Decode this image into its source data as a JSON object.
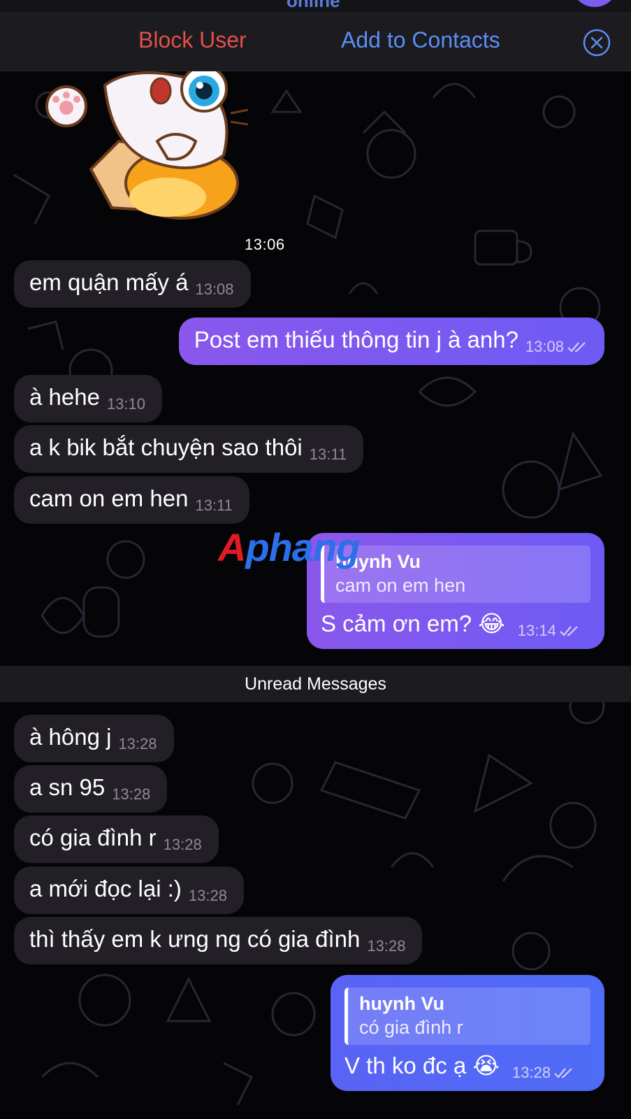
{
  "header": {
    "status_text": "online",
    "block_user": "Block User",
    "add_to_contacts": "Add to Contacts"
  },
  "watermark": {
    "first": "A",
    "rest": "phang"
  },
  "chat": {
    "timestamp_label": "13:06",
    "unread_label": "Unread Messages",
    "messages": [
      {
        "dir": "in",
        "text": "em quận mấy á",
        "time": "13:08"
      },
      {
        "dir": "out",
        "text": "Post em thiếu thông tin j à anh?",
        "time": "13:08"
      },
      {
        "dir": "in",
        "text": "à hehe",
        "time": "13:10"
      },
      {
        "dir": "in",
        "text": "a k bik bắt chuyện sao thôi",
        "time": "13:11"
      },
      {
        "dir": "in",
        "text": "cam on em hen",
        "time": "13:11"
      },
      {
        "dir": "out",
        "reply_name": "huynh Vu",
        "reply_text": "cam on em hen",
        "text": "S cảm ơn em? 😂",
        "time": "13:14"
      },
      {
        "dir": "in",
        "text": "à hông j",
        "time": "13:28"
      },
      {
        "dir": "in",
        "text": "a sn 95",
        "time": "13:28"
      },
      {
        "dir": "in",
        "text": "có gia đình r",
        "time": "13:28"
      },
      {
        "dir": "in",
        "text": "a mới đọc lại :)",
        "time": "13:28"
      },
      {
        "dir": "in",
        "text": "thì thấy em k ưng ng có gia đình",
        "time": "13:28"
      },
      {
        "dir": "out",
        "reply_name": "huynh Vu",
        "reply_text": "có gia đình r",
        "text": "V th ko đc ạ 😭",
        "time": "13:28"
      }
    ]
  },
  "colors": {
    "background": "#050407",
    "incoming_bubble": "#231f27",
    "outgoing_bubble": "#7b58f0",
    "block_red": "#e0514a",
    "link_blue": "#5b8ef5"
  },
  "icons": [
    "close-circle-icon",
    "double-check-icon",
    "cat-sticker"
  ]
}
